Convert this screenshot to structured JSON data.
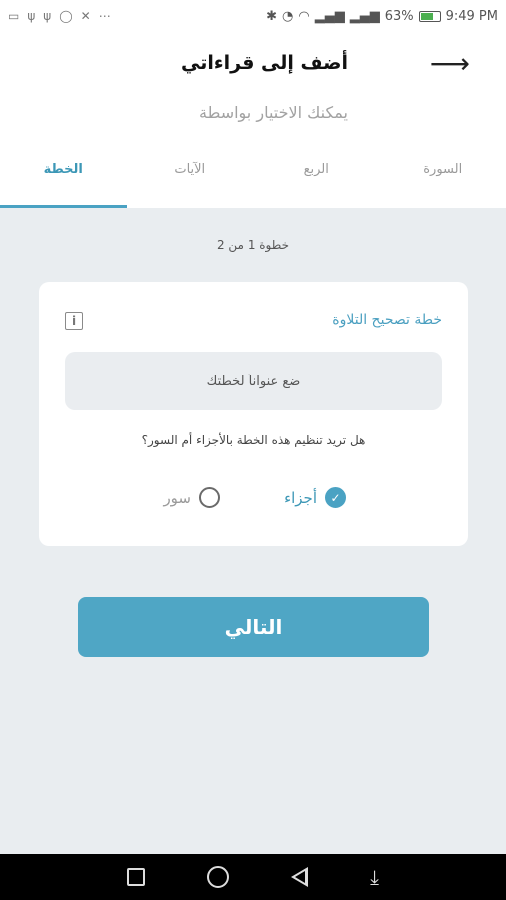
{
  "status_bar": {
    "battery": "63%",
    "time": "9:49 PM"
  },
  "header": {
    "title": "أضف إلى قراءاتي",
    "subtitle": "يمكنك الاختيار بواسطة"
  },
  "tabs": [
    {
      "label": "السورة",
      "active": false
    },
    {
      "label": "الربع",
      "active": false
    },
    {
      "label": "الآيات",
      "active": false
    },
    {
      "label": "الخطة",
      "active": true
    }
  ],
  "step": "خطوة 1 من 2",
  "card": {
    "plan_label": "خطة تصحيح التلاوة",
    "input_placeholder": "ضع عنواناً لخطتك",
    "question": "هل تريد تنظيم هذه الخطة بالأجزاء أم السور؟",
    "options": [
      {
        "label": "أجزاء",
        "checked": true
      },
      {
        "label": "سور",
        "checked": false
      }
    ]
  },
  "next_button": "التالي",
  "colors": {
    "accent": "#4fa6c5",
    "background": "#e9edf0"
  }
}
